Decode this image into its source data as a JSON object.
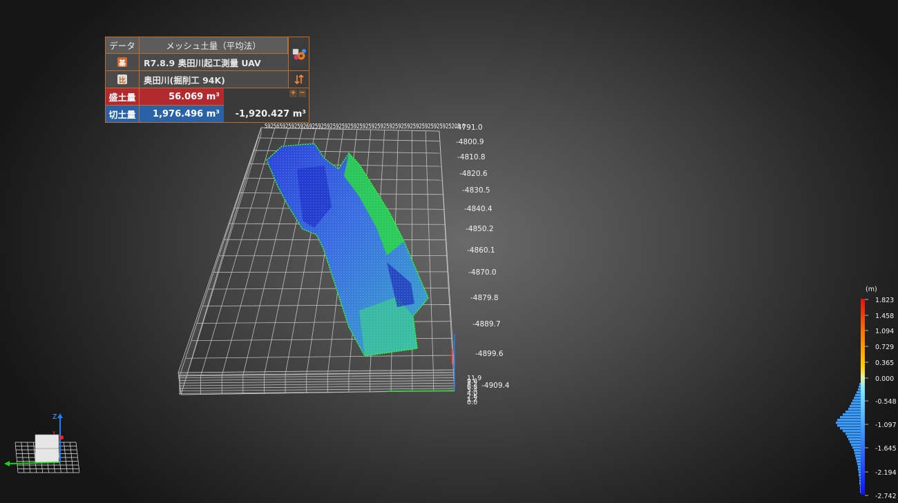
{
  "panel": {
    "header_data": "データ",
    "header_title": "メッシュ土量（平均法）",
    "base_badge": "基",
    "base_name": "R7.8.9 奥田川起工測量 UAV",
    "compare_badge": "比",
    "compare_name": "奥田川(掘削工 94K)",
    "fill_label": "盛土量",
    "fill_value": "56.069 m³",
    "cut_label": "切土量",
    "cut_value": "1,976.496 m³",
    "net_value": "-1,920.427 m³",
    "plus": "+",
    "minus": "−"
  },
  "axis": {
    "top_labels": "592565925925926925925925925925925925925925925925925925925925925205.6",
    "right_labels": [
      "-4791.0",
      "-4800.9",
      "-4810.8",
      "-4820.6",
      "-4830.5",
      "-4840.4",
      "-4850.2",
      "-4860.1",
      "-4870.0",
      "-4879.8",
      "-4889.7",
      "-4899.6",
      "-4909.4"
    ],
    "z_labels": [
      "11.9",
      "9.6",
      "8.2",
      "6.8",
      "5.4",
      "4.0",
      "2.6",
      "1.2",
      "0.0"
    ]
  },
  "legend": {
    "unit": "(m)",
    "ticks": [
      "1.823",
      "1.458",
      "1.094",
      "0.729",
      "0.365",
      "0.000",
      "-0.548",
      "-1.097",
      "-1.645",
      "-2.194",
      "-2.742"
    ],
    "colors": {
      "high": "#e01010",
      "mid": "#ffd000",
      "zero": "#80e8ff",
      "low": "#1010ff"
    }
  },
  "triad": {
    "z": "Z",
    "y": "Y"
  }
}
